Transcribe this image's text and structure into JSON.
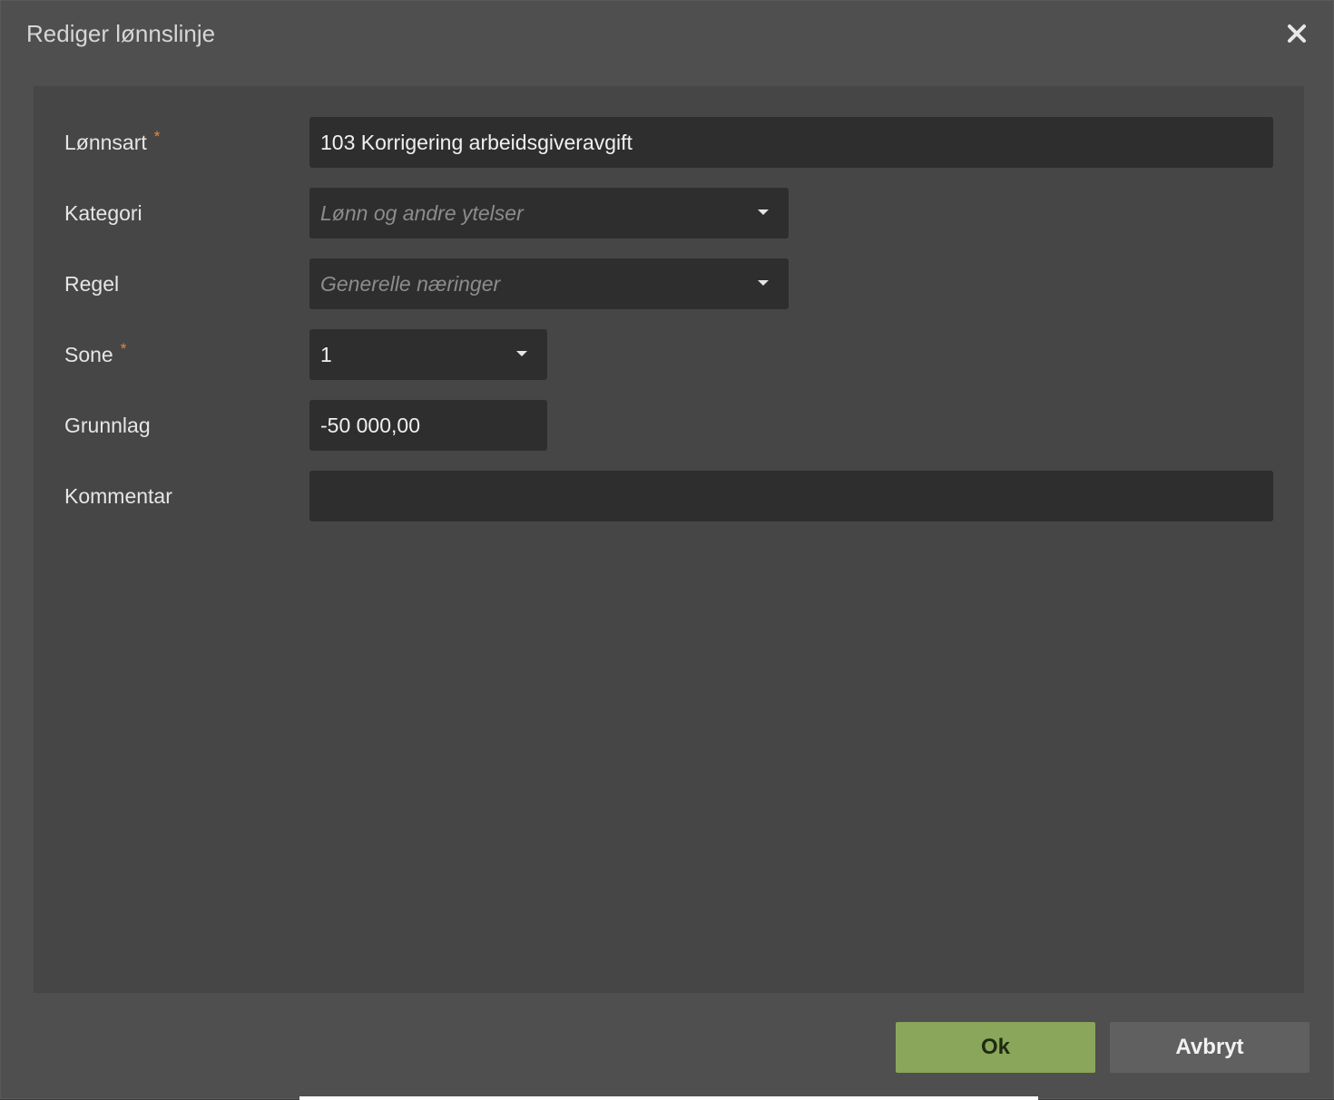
{
  "dialog": {
    "title": "Rediger lønnslinje",
    "close_icon": "close-icon"
  },
  "form": {
    "required_marker": "*",
    "lonnsart": {
      "label": "Lønnsart",
      "required": true,
      "value": "103 Korrigering arbeidsgiveravgift"
    },
    "kategori": {
      "label": "Kategori",
      "placeholder": "Lønn og andre ytelser",
      "value": ""
    },
    "regel": {
      "label": "Regel",
      "placeholder": "Generelle næringer",
      "value": ""
    },
    "sone": {
      "label": "Sone",
      "required": true,
      "value": "1"
    },
    "grunnlag": {
      "label": "Grunnlag",
      "value": "-50 000,00"
    },
    "kommentar": {
      "label": "Kommentar",
      "value": ""
    }
  },
  "buttons": {
    "ok": "Ok",
    "cancel": "Avbryt"
  },
  "colors": {
    "ok_button": "#8aa65a",
    "cancel_button": "#606060",
    "required_marker": "#e8883a",
    "input_background": "#2e2e2e"
  }
}
